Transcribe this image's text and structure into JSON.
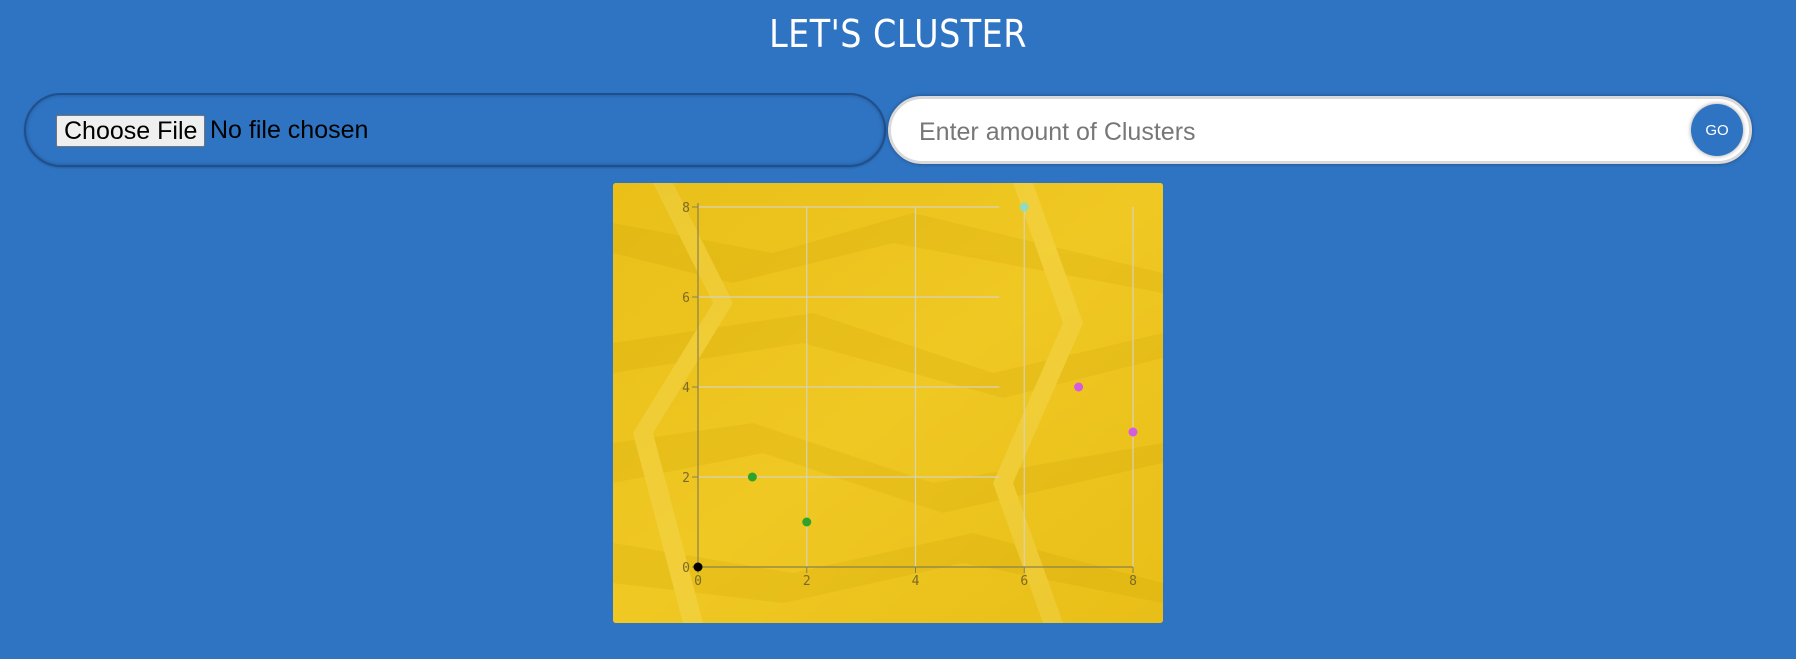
{
  "header": {
    "title": "LET'S CLUSTER"
  },
  "file_input": {
    "button_label": "Choose File",
    "status": "No file chosen"
  },
  "cluster_input": {
    "placeholder": "Enter amount of Clusters",
    "value": "",
    "go_label": "GO"
  },
  "colors": {
    "background": "#2f74c3",
    "chart_bg": "#ecc41c",
    "cluster_a": "#2ea32a",
    "cluster_b": "#d35ce0",
    "cluster_c": "#8fdcc0",
    "origin": "#000000"
  },
  "chart_data": {
    "type": "scatter",
    "title": "",
    "xlabel": "",
    "ylabel": "",
    "xlim": [
      0,
      8
    ],
    "ylim": [
      0,
      8
    ],
    "xticks": [
      0,
      2,
      4,
      6,
      8
    ],
    "yticks": [
      0,
      2,
      4,
      6,
      8
    ],
    "grid": true,
    "points": [
      {
        "x": 0,
        "y": 0,
        "color": "#000000"
      },
      {
        "x": 1,
        "y": 2,
        "color": "#2ea32a"
      },
      {
        "x": 2,
        "y": 1,
        "color": "#2ea32a"
      },
      {
        "x": 6,
        "y": 8,
        "color": "#8fdcc0"
      },
      {
        "x": 7,
        "y": 4,
        "color": "#d35ce0"
      },
      {
        "x": 8,
        "y": 3,
        "color": "#d35ce0"
      }
    ]
  }
}
